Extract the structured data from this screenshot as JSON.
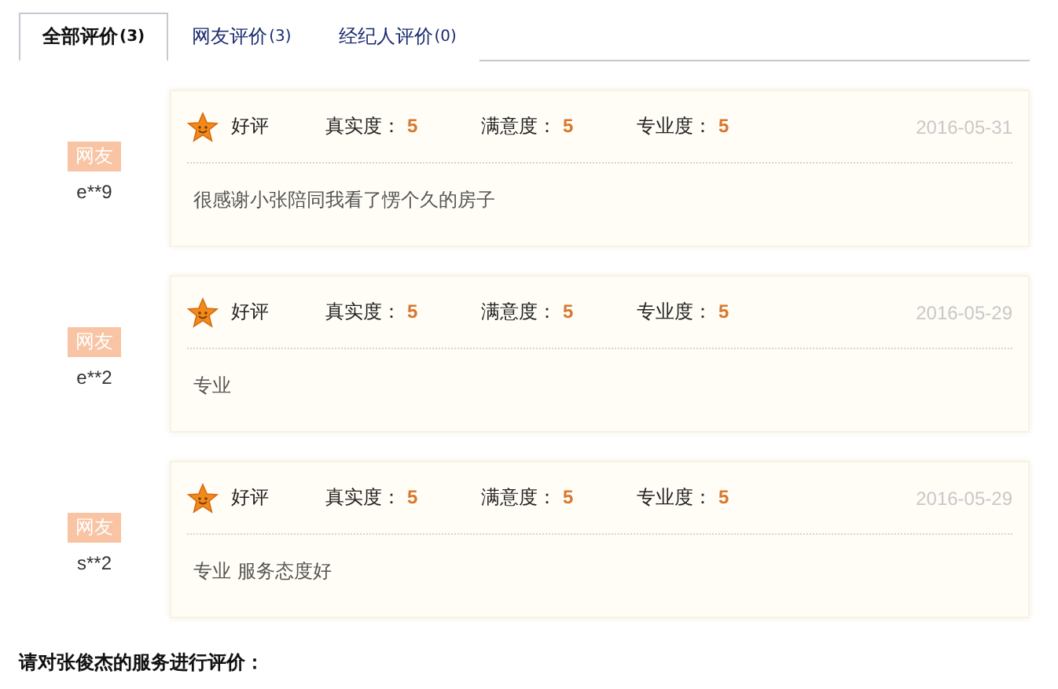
{
  "tabs": [
    {
      "label": "全部评价",
      "count": "(3)",
      "selected": true
    },
    {
      "label": "网友评价",
      "count": "(3)",
      "selected": false
    },
    {
      "label": "经纪人评价",
      "count": "(0)",
      "selected": false
    }
  ],
  "reviews": [
    {
      "badge": "网友",
      "user": "e**9",
      "verdict": "好评",
      "ratings": [
        {
          "label": "真实度：",
          "value": "5"
        },
        {
          "label": "满意度：",
          "value": "5"
        },
        {
          "label": "专业度：",
          "value": "5"
        }
      ],
      "date": "2016-05-31",
      "comment": "很感谢小张陪同我看了愣个久的房子"
    },
    {
      "badge": "网友",
      "user": "e**2",
      "verdict": "好评",
      "ratings": [
        {
          "label": "真实度：",
          "value": "5"
        },
        {
          "label": "满意度：",
          "value": "5"
        },
        {
          "label": "专业度：",
          "value": "5"
        }
      ],
      "date": "2016-05-29",
      "comment": "专业"
    },
    {
      "badge": "网友",
      "user": "s**2",
      "verdict": "好评",
      "ratings": [
        {
          "label": "真实度：",
          "value": "5"
        },
        {
          "label": "满意度：",
          "value": "5"
        },
        {
          "label": "专业度：",
          "value": "5"
        }
      ],
      "date": "2016-05-29",
      "comment": "专业 服务态度好"
    }
  ],
  "prompt": "请对张俊杰的服务进行评价："
}
